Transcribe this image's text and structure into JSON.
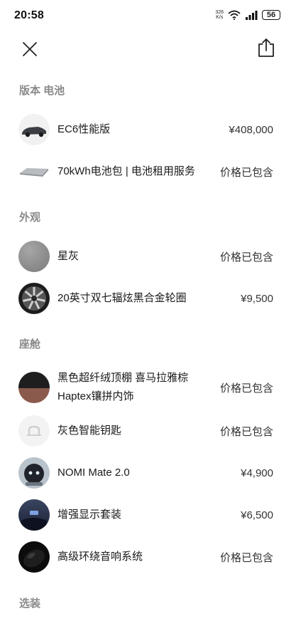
{
  "status_bar": {
    "time": "20:58",
    "net_speed_value": "326",
    "net_speed_unit": "K/s",
    "battery": "56"
  },
  "nav": {
    "close_icon": "close-icon",
    "share_icon": "share-icon"
  },
  "sections": {
    "version_battery": "版本 电池",
    "exterior": "外观",
    "cabin": "座舱",
    "options": "选装"
  },
  "items": {
    "ec6": {
      "label": "EC6性能版",
      "price": "¥408,000"
    },
    "battery_pack": {
      "label": "70kWh电池包 | 电池租用服务",
      "price": "价格已包含"
    },
    "star_gray": {
      "label": "星灰",
      "price": "价格已包含"
    },
    "wheels": {
      "label": "20英寸双七辐炫黑合金轮圈",
      "price": "¥9,500"
    },
    "interior": {
      "label_line1": "黑色超纤绒顶棚 喜马拉雅棕",
      "label_line2": "Haptex镶拼内饰",
      "price": "价格已包含"
    },
    "smart_key": {
      "label": "灰色智能钥匙",
      "price": "价格已包含"
    },
    "nomi": {
      "label": "NOMI Mate 2.0",
      "price": "¥4,900"
    },
    "display": {
      "label": "增强显示套装",
      "price": "¥6,500"
    },
    "audio": {
      "label": "高级环绕音响系统",
      "price": "价格已包含"
    }
  },
  "colors": {
    "section_title": "#8a8a8a",
    "text": "#1a1a1a",
    "star_gray": "#8d8d8d",
    "interior_brown": "#8a5a4c"
  }
}
